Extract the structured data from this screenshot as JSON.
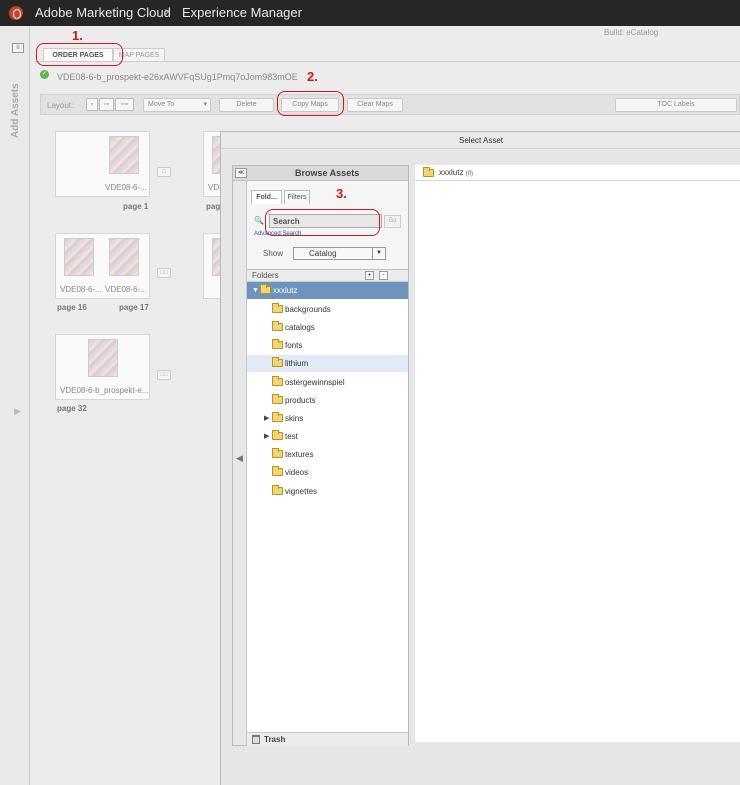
{
  "topbar": {
    "app_title": "Adobe Marketing Cloud",
    "section_title": "Experience Manager"
  },
  "sidebar": {
    "label": "Add Assets"
  },
  "build": "Build: eCatalog",
  "tabs": [
    {
      "label": "ORDER PAGES"
    },
    {
      "label": "MAP PAGES"
    }
  ],
  "filename": "VDE08-6-b_prospekt-e26xAWVFqSUg1Pmq7oJom983mOE",
  "toolbar": {
    "layout_label": "Layout:",
    "move_to": "Move To",
    "delete": "Delete",
    "copy_maps": "Copy Maps",
    "clear_maps": "Clear Maps",
    "toc_labels": "TOC Labels"
  },
  "pages": [
    {
      "caption": "VDE08-6-...",
      "page": "page 1"
    },
    {
      "caption": "VDE08-6-...",
      "page": "page 16"
    },
    {
      "caption": "VDE08-6-...",
      "page": "page 17"
    },
    {
      "caption": "VDE08-6-b_prospekt-e...",
      "page": "page 32"
    },
    {
      "caption": "VDE",
      "page": "page"
    }
  ],
  "annotations": {
    "a1": "1.",
    "a2": "2.",
    "a3": "3."
  },
  "dialog": {
    "title": "Select Asset",
    "browse_title": "Browse Assets",
    "tabs": [
      {
        "label": "Fold..."
      },
      {
        "label": "Filters"
      }
    ],
    "search_placeholder": "Search",
    "go": "Go",
    "advanced_search": "Advanced Search",
    "show_label": "Show",
    "show_value": "Catalog",
    "folders_header": "Folders",
    "folders": [
      {
        "name": "xxxlutz"
      },
      {
        "name": "backgrounds"
      },
      {
        "name": "catalogs"
      },
      {
        "name": "fonts"
      },
      {
        "name": "lithium"
      },
      {
        "name": "ostergewinnspiel"
      },
      {
        "name": "products"
      },
      {
        "name": "skins"
      },
      {
        "name": "test"
      },
      {
        "name": "textures"
      },
      {
        "name": "videos"
      },
      {
        "name": "vignettes"
      }
    ],
    "trash": "Trash",
    "right_folder": "xxxlutz",
    "right_count": "(0)"
  },
  "colors": {
    "accent_red": "#cc1b1b",
    "selected_row": "#6e93bd",
    "topbar": "#262626"
  }
}
